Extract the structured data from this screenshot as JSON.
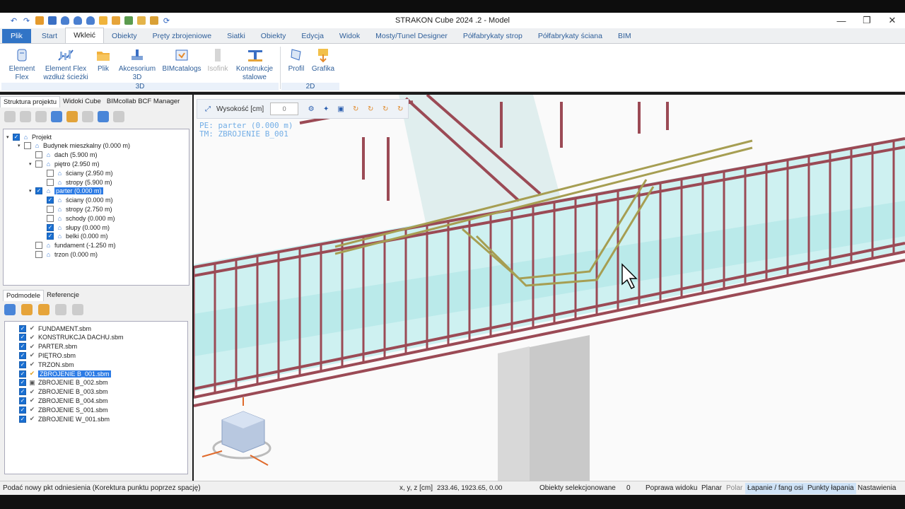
{
  "window": {
    "title": "STRAKON Cube 2024 .2 - Model",
    "controls": [
      "minimize-icon",
      "restore-icon",
      "close-icon"
    ]
  },
  "quick_access": [
    "undo-icon",
    "redo-icon",
    "save-icon",
    "save-all-icon",
    "database-icon",
    "database-icon",
    "database-icon",
    "folder-icon",
    "export-icon",
    "image-icon",
    "image-icon",
    "print-icon",
    "refresh-icon"
  ],
  "tabs": [
    "Plik",
    "Start",
    "Wkleić",
    "Obiekty",
    "Pręty zbrojeniowe",
    "Siatki",
    "Obiekty",
    "Edycja",
    "Widok",
    "Mosty/Tunel Designer",
    "Półfabrykaty strop",
    "Półfabrykaty ściana",
    "BIM"
  ],
  "active_tab": "Wkleić",
  "ribbon": {
    "group_3d": {
      "label": "3D",
      "buttons": [
        {
          "l1": "Element",
          "l2": "Flex",
          "enabled": true
        },
        {
          "l1": "Element Flex",
          "l2": "wzdłuż ścieżki",
          "enabled": true
        },
        {
          "l1": "Plik",
          "l2": "",
          "enabled": true
        },
        {
          "l1": "Akcesorium",
          "l2": "3D",
          "enabled": true
        },
        {
          "l1": "BIMcatalogs",
          "l2": "",
          "enabled": true
        },
        {
          "l1": "Isofink",
          "l2": "",
          "enabled": false
        },
        {
          "l1": "Konstrukcje",
          "l2": "stalowe",
          "enabled": true
        }
      ]
    },
    "group_2d": {
      "label": "2D",
      "buttons": [
        {
          "l1": "Profil",
          "l2": ""
        },
        {
          "l1": "Grafika",
          "l2": ""
        }
      ]
    }
  },
  "left_panel": {
    "tabs": [
      "Struktura projektu",
      "Widoki Cube",
      "BIMcollab BCF Manager"
    ],
    "tree": [
      {
        "label": "Projekt",
        "level": 0,
        "checked": true,
        "expand": "▾"
      },
      {
        "label": "Budynek mieszkalny (0.000 m)",
        "level": 1,
        "checked": false,
        "expand": "▾"
      },
      {
        "label": "dach (5.900 m)",
        "level": 2,
        "checked": false,
        "expand": ""
      },
      {
        "label": "piętro (2.950 m)",
        "level": 2,
        "checked": false,
        "expand": "▾"
      },
      {
        "label": "ściany (2.950 m)",
        "level": 3,
        "checked": false,
        "expand": ""
      },
      {
        "label": "stropy (5.900 m)",
        "level": 3,
        "checked": false,
        "expand": ""
      },
      {
        "label": "parter (0.000 m)",
        "level": 2,
        "checked": true,
        "expand": "▾",
        "selected": true
      },
      {
        "label": "ściany (0.000 m)",
        "level": 3,
        "checked": true,
        "expand": ""
      },
      {
        "label": "stropy (2.750 m)",
        "level": 3,
        "checked": false,
        "expand": ""
      },
      {
        "label": "schody (0.000 m)",
        "level": 3,
        "checked": false,
        "expand": ""
      },
      {
        "label": "słupy (0.000 m)",
        "level": 3,
        "checked": true,
        "expand": ""
      },
      {
        "label": "belki (0.000 m)",
        "level": 3,
        "checked": true,
        "expand": ""
      },
      {
        "label": "fundament (-1.250 m)",
        "level": 2,
        "checked": false,
        "expand": ""
      },
      {
        "label": "trzon (0.000 m)",
        "level": 2,
        "checked": false,
        "expand": ""
      }
    ],
    "sub_tabs": [
      "Podmodele",
      "Referencje"
    ],
    "submodels": [
      {
        "name": "FUNDAMENT.sbm",
        "state": "check"
      },
      {
        "name": "KONSTRUKCJA DACHU.sbm",
        "state": "check"
      },
      {
        "name": "PARTER.sbm",
        "state": "check"
      },
      {
        "name": "PIĘTRO.sbm",
        "state": "check"
      },
      {
        "name": "TRZON.sbm",
        "state": "check"
      },
      {
        "name": "ZBROJENIE B_001.sbm",
        "state": "active",
        "selected": true
      },
      {
        "name": "ZBROJENIE B_002.sbm",
        "state": "lock"
      },
      {
        "name": "ZBROJENIE B_003.sbm",
        "state": "check"
      },
      {
        "name": "ZBROJENIE B_004.sbm",
        "state": "check"
      },
      {
        "name": "ZBROJENIE S_001.sbm",
        "state": "check"
      },
      {
        "name": "ZBROJENIE W_001.sbm",
        "state": "check"
      }
    ]
  },
  "viewport": {
    "height_label": "Wysokość [cm]",
    "height_value": "0",
    "info_line1": "PE: parter (0.000 m)",
    "info_line2": "TM: ZBROJENIE B_001"
  },
  "status": {
    "prompt": "Podać nowy pkt odniesienia (Korektura punktu poprzez spację)",
    "coord_label": "x, y, z [cm]",
    "coord_value": "233.46, 1923.65, 0.00",
    "selected_label": "Obiekty selekcjonowane",
    "selected_count": "0",
    "items": [
      "Poprawa widoku",
      "Planar",
      "Polar",
      "Łapanie / fang osi",
      "Punkty łapania",
      "Nastawienia"
    ]
  },
  "colors": {
    "accent": "#3174c6",
    "rebar": "#9b4a55",
    "concrete": "#aee6e6",
    "column": "#c9c9c9"
  }
}
